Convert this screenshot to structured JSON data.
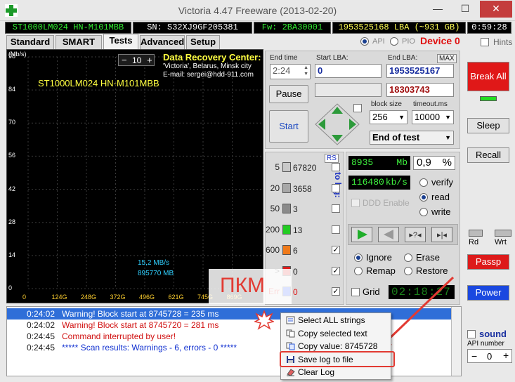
{
  "window": {
    "title": "Victoria 4.47   Freeware (2013-02-20)",
    "minimize": "—",
    "maximize": "☐",
    "close": "✕"
  },
  "infobar": {
    "model": "ST1000LM024 HN-M101MBB",
    "serial": "SN: S32XJ9GF205381",
    "firmware": "Fw: 2BA30001",
    "capacity": "1953525168 LBA (~931 GB)",
    "time": "0:59:28"
  },
  "mode": {
    "api": "API",
    "pio": "PIO",
    "device": "Device 0",
    "hints": "Hints"
  },
  "tabs": [
    "Standard",
    "SMART",
    "Tests",
    "Advanced",
    "Setup"
  ],
  "graph": {
    "y_unit": "(Mb/s)",
    "y_ticks": [
      "98",
      "84",
      "70",
      "56",
      "42",
      "28",
      "14",
      "0"
    ],
    "x_ticks": [
      "0",
      "124G",
      "248G",
      "372G",
      "496G",
      "621G",
      "745G",
      "869G"
    ],
    "drive_label": "ST1000LM024 HN-M101MBB",
    "stepper_minus": "−",
    "stepper_value": "10",
    "stepper_plus": "+",
    "drc_title": "Data Recovery Center:",
    "drc_line1": "'Victoria', Belarus, Minsk city",
    "drc_line2": "E-mail: sergei@hdd-911.com",
    "speed": "15,2 MB/s",
    "speed_mb": "895770 MB"
  },
  "controls": {
    "end_time_label": "End time",
    "end_time_value": "2:24",
    "start_lba_label": "Start LBA:",
    "start_lba_value": "0",
    "end_lba_label": "End LBA:",
    "max_label": "MAX",
    "end_lba_value": "1953525167",
    "current_lba_value": "18303743",
    "pause": "Pause",
    "start": "Start",
    "block_size_label": "block size",
    "block_size_value": "256",
    "timeout_label": "timeout.ms",
    "timeout_value": "10000",
    "end_action": "End of test"
  },
  "counters": {
    "rs": "RS",
    "to_log": "to log:",
    "rows": [
      {
        "ms": "5",
        "count": "67820",
        "color": "#c8c8c8",
        "log": false
      },
      {
        "ms": "20",
        "count": "3658",
        "color": "#a8a8a8",
        "log": false
      },
      {
        "ms": "50",
        "count": "3",
        "color": "#8a8a8a",
        "log": false
      },
      {
        "ms": "200",
        "count": "13",
        "color": "#22cc22",
        "log": false
      },
      {
        "ms": "600",
        "count": "6",
        "color": "#f07a1a",
        "log": true
      },
      {
        "ms": ">",
        "count": "0",
        "color": "#dd1f1f",
        "log": true
      },
      {
        "ms": "Err",
        "count": "0",
        "color": "#1a48ff",
        "log": true
      }
    ]
  },
  "stats": {
    "pos_value": "8935",
    "pos_unit": "Mb",
    "percent_value": "0,9",
    "percent_unit": "%",
    "speed_value": "116480",
    "speed_unit": "kb/s",
    "ddd": "DDD Enable",
    "verify": "verify",
    "read": "read",
    "write": "write",
    "ignore": "Ignore",
    "erase": "Erase",
    "remap": "Remap",
    "restore": "Restore",
    "grid": "Grid",
    "elapsed": "02:18:27"
  },
  "side": {
    "break_all": "Break All",
    "sleep": "Sleep",
    "recall": "Recall",
    "rd": "Rd",
    "wrt": "Wrt",
    "passp": "Passp",
    "power": "Power",
    "sound": "sound",
    "api_number": "API number",
    "api_value": "0",
    "api_minus": "−",
    "api_plus": "+"
  },
  "log": [
    {
      "time": "0:24:02",
      "msg": "Warning! Block start at 8745728 = 235 ms",
      "color": "#d01010",
      "selected": true
    },
    {
      "time": "0:24:02",
      "msg": "Warning! Block start at 8745720 = 281 ms",
      "color": "#d01010",
      "selected": false
    },
    {
      "time": "0:24:45",
      "msg": "Command interrupted by user!",
      "color": "#d01010",
      "selected": false
    },
    {
      "time": "0:24:45",
      "msg": "***** Scan results: Warnings - 6, errors - 0 *****",
      "color": "#1030d0",
      "selected": false
    }
  ],
  "annotation": {
    "pkm": "ПКМ"
  },
  "context_menu": [
    {
      "label": "Select ALL strings",
      "icon": "select-all-icon"
    },
    {
      "label": "Copy selected text",
      "icon": "copy-icon"
    },
    {
      "label": "Copy value: 8745728",
      "icon": "copy-value-icon"
    },
    {
      "label": "Save log to file",
      "icon": "floppy-disk-icon"
    },
    {
      "label": "Clear Log",
      "icon": "eraser-icon"
    }
  ]
}
